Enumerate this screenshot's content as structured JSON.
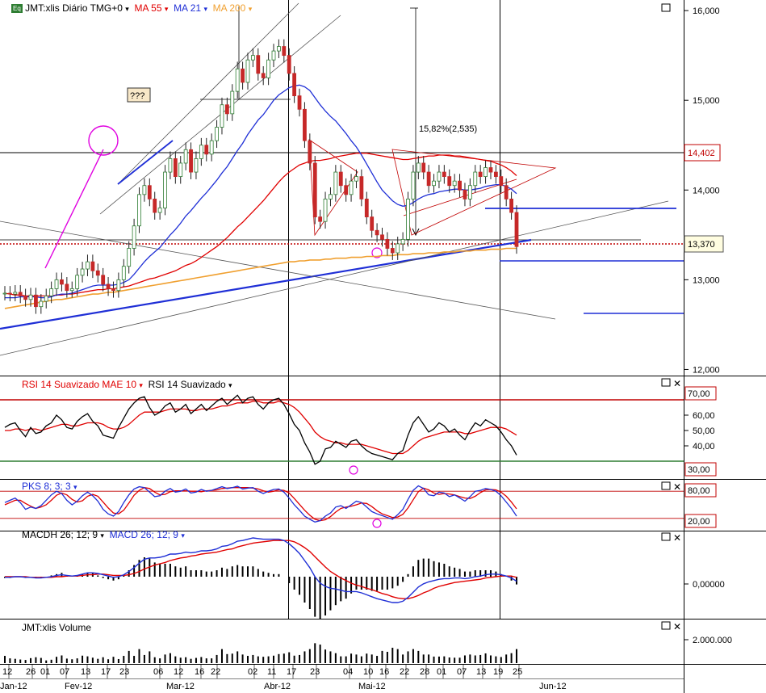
{
  "colors": {
    "up": "#2e7d32",
    "down": "#c62828",
    "ma55": "#e00000",
    "ma21": "#1f2fd6",
    "ma200": "#f0a030",
    "rsi": "#000000",
    "rsiMae": "#e00000",
    "pks_k": "#1f2fd6",
    "pks_d": "#e00000",
    "trend": "#1f2fd6",
    "level": "#c00000",
    "magenta": "#e000e0"
  },
  "header": {
    "eq_icon": "Eq",
    "symbol": "JMT:xlis Diário TMG+0",
    "ma55": "MA 55",
    "ma21": "MA 21",
    "ma200": "MA 200",
    "dropdown_glyph": "▾"
  },
  "annotations": {
    "question": "???",
    "pct_move": "15,82%(2,535)"
  },
  "panels": {
    "rsi": {
      "title_a": "RSI 14 Suavizado MAE 10",
      "title_b": "RSI 14 Suavizado",
      "levels": [
        "70,00",
        "30,00"
      ]
    },
    "pks": {
      "title": "PKS 8; 3; 3",
      "levels": [
        "80,00",
        "20,00"
      ]
    },
    "macd": {
      "title_a": "MACDH 26; 12; 9",
      "title_b": "MACD 26; 12; 9",
      "zero": "0,00000"
    },
    "volume": {
      "title": "JMT:xlis Volume",
      "tick": "2.000.000"
    }
  },
  "window_controls": {
    "maximize": "□",
    "close": "✕"
  },
  "chart_data": {
    "type": "candlestick",
    "price_axis": {
      "ticks": [
        "16,000",
        "15,000",
        "14,000",
        "13,000",
        "12,000"
      ],
      "ylim": [
        11.95,
        16.1
      ]
    },
    "price_tags": {
      "resistance": "14,402",
      "last": "13,370"
    },
    "x_day_labels": [
      "12",
      "26",
      "01",
      "07",
      "13",
      "17",
      "23",
      "06",
      "12",
      "16",
      "22",
      "02",
      "11",
      "17",
      "23",
      "04",
      "10",
      "16",
      "22",
      "28",
      "01",
      "07",
      "13",
      "19",
      "25"
    ],
    "x_month_labels": [
      "Jan-12",
      "Fev-12",
      "Mar-12",
      "Abr-12",
      "Mai-12",
      "Jun-12"
    ],
    "close": [
      12.85,
      12.84,
      12.86,
      12.82,
      12.78,
      12.83,
      12.7,
      12.76,
      12.82,
      12.9,
      13.0,
      12.95,
      12.88,
      12.9,
      13.05,
      13.12,
      13.2,
      13.1,
      13.05,
      12.95,
      12.9,
      12.88,
      13.0,
      13.15,
      13.35,
      13.6,
      13.95,
      14.05,
      13.9,
      13.75,
      13.8,
      14.2,
      14.35,
      14.15,
      14.3,
      14.45,
      14.2,
      14.35,
      14.5,
      14.4,
      14.55,
      14.7,
      14.95,
      14.85,
      15.1,
      15.35,
      15.2,
      15.45,
      15.5,
      15.3,
      15.25,
      15.45,
      15.55,
      15.6,
      15.5,
      15.3,
      15.05,
      14.9,
      14.55,
      14.3,
      13.7,
      13.65,
      13.9,
      13.95,
      14.2,
      14.05,
      13.95,
      14.1,
      14.15,
      13.9,
      13.7,
      13.55,
      13.5,
      13.45,
      13.35,
      13.3,
      13.4,
      13.45,
      13.9,
      14.2,
      14.3,
      14.2,
      14.05,
      14.1,
      14.2,
      14.15,
      14.05,
      14.1,
      14.0,
      13.9,
      14.05,
      14.2,
      14.15,
      14.25,
      14.2,
      14.15,
      14.05,
      13.9,
      13.75,
      13.37
    ],
    "ma21": [
      12.8,
      12.8,
      12.8,
      12.81,
      12.81,
      12.81,
      12.81,
      12.8,
      12.8,
      12.81,
      12.83,
      12.84,
      12.84,
      12.85,
      12.87,
      12.89,
      12.91,
      12.93,
      12.94,
      12.94,
      12.94,
      12.94,
      12.95,
      12.97,
      13.0,
      13.06,
      13.13,
      13.2,
      13.26,
      13.31,
      13.36,
      13.43,
      13.5,
      13.56,
      13.63,
      13.71,
      13.77,
      13.84,
      13.91,
      13.97,
      14.04,
      14.11,
      14.19,
      14.26,
      14.35,
      14.44,
      14.52,
      14.62,
      14.7,
      14.78,
      14.84,
      14.92,
      15.0,
      15.06,
      15.1,
      15.14,
      15.16,
      15.17,
      15.15,
      15.11,
      15.03,
      14.95,
      14.88,
      14.82,
      14.77,
      14.7,
      14.63,
      14.55,
      14.48,
      14.39,
      14.29,
      14.19,
      14.09,
      14.0,
      13.94,
      13.88,
      13.84,
      13.82,
      13.83,
      13.86,
      13.9,
      13.93,
      13.95,
      13.96,
      13.98,
      13.99,
      14.0,
      14.01,
      14.01,
      14.0,
      14.0,
      14.01,
      14.02,
      14.04,
      14.05,
      14.06,
      14.06,
      14.04,
      14.01,
      13.96
    ],
    "ma55": [
      12.85,
      12.84,
      12.83,
      12.83,
      12.82,
      12.82,
      12.82,
      12.82,
      12.82,
      12.82,
      12.83,
      12.83,
      12.84,
      12.84,
      12.85,
      12.86,
      12.87,
      12.88,
      12.89,
      12.89,
      12.9,
      12.9,
      12.91,
      12.92,
      12.93,
      12.95,
      12.97,
      12.99,
      13.01,
      13.02,
      13.04,
      13.06,
      13.08,
      13.1,
      13.13,
      13.16,
      13.18,
      13.21,
      13.25,
      13.29,
      13.33,
      13.37,
      13.42,
      13.47,
      13.53,
      13.59,
      13.64,
      13.7,
      13.76,
      13.82,
      13.88,
      13.95,
      14.02,
      14.09,
      14.15,
      14.2,
      14.24,
      14.28,
      14.3,
      14.32,
      14.33,
      14.33,
      14.34,
      14.35,
      14.37,
      14.38,
      14.39,
      14.4,
      14.41,
      14.41,
      14.41,
      14.4,
      14.39,
      14.38,
      14.37,
      14.36,
      14.35,
      14.34,
      14.34,
      14.35,
      14.36,
      14.37,
      14.38,
      14.38,
      14.39,
      14.39,
      14.39,
      14.38,
      14.38,
      14.37,
      14.36,
      14.35,
      14.34,
      14.33,
      14.32,
      14.3,
      14.28,
      14.25,
      14.21,
      14.16
    ],
    "ma200": [
      12.68,
      12.69,
      12.7,
      12.71,
      12.72,
      12.73,
      12.74,
      12.75,
      12.76,
      12.77,
      12.78,
      12.78,
      12.79,
      12.8,
      12.81,
      12.82,
      12.83,
      12.84,
      12.84,
      12.85,
      12.86,
      12.86,
      12.87,
      12.88,
      12.89,
      12.9,
      12.91,
      12.92,
      12.93,
      12.94,
      12.95,
      12.96,
      12.97,
      12.98,
      12.99,
      13.0,
      13.01,
      13.02,
      13.03,
      13.04,
      13.05,
      13.06,
      13.07,
      13.08,
      13.09,
      13.1,
      13.11,
      13.12,
      13.13,
      13.14,
      13.15,
      13.16,
      13.17,
      13.18,
      13.19,
      13.2,
      13.2,
      13.21,
      13.21,
      13.22,
      13.22,
      13.22,
      13.23,
      13.23,
      13.24,
      13.24,
      13.24,
      13.25,
      13.25,
      13.25,
      13.26,
      13.26,
      13.26,
      13.27,
      13.27,
      13.27,
      13.28,
      13.28,
      13.28,
      13.29,
      13.29,
      13.29,
      13.3,
      13.3,
      13.3,
      13.31,
      13.31,
      13.31,
      13.32,
      13.32,
      13.32,
      13.33,
      13.33,
      13.33,
      13.34,
      13.34,
      13.34,
      13.35,
      13.35,
      13.35
    ],
    "rsi": [
      52,
      54,
      55,
      50,
      46,
      52,
      48,
      49,
      53,
      55,
      60,
      57,
      52,
      51,
      56,
      59,
      61,
      56,
      53,
      47,
      46,
      45,
      52,
      58,
      64,
      68,
      71,
      72,
      65,
      60,
      62,
      66,
      68,
      62,
      64,
      67,
      61,
      64,
      67,
      63,
      66,
      69,
      71,
      67,
      70,
      73,
      68,
      71,
      72,
      67,
      64,
      68,
      70,
      71,
      67,
      61,
      54,
      50,
      42,
      36,
      28,
      30,
      38,
      39,
      43,
      41,
      39,
      43,
      44,
      40,
      37,
      35,
      34,
      33,
      32,
      31,
      35,
      37,
      47,
      55,
      59,
      54,
      49,
      51,
      55,
      53,
      49,
      51,
      47,
      44,
      50,
      55,
      53,
      57,
      55,
      53,
      49,
      44,
      40,
      34
    ],
    "rsiMae": [
      50,
      50,
      51,
      51,
      50,
      51,
      51,
      50,
      51,
      52,
      53,
      54,
      54,
      53,
      53,
      54,
      55,
      55,
      55,
      54,
      52,
      51,
      51,
      52,
      54,
      57,
      60,
      62,
      62,
      62,
      62,
      63,
      64,
      64,
      64,
      64,
      63,
      63,
      64,
      64,
      64,
      65,
      66,
      66,
      67,
      68,
      68,
      68,
      69,
      69,
      68,
      68,
      68,
      69,
      68,
      67,
      65,
      62,
      58,
      54,
      49,
      46,
      44,
      43,
      42,
      42,
      41,
      41,
      41,
      41,
      40,
      39,
      38,
      37,
      36,
      35,
      35,
      35,
      37,
      40,
      43,
      45,
      46,
      47,
      48,
      49,
      49,
      49,
      49,
      48,
      48,
      49,
      50,
      51,
      52,
      52,
      52,
      51,
      49,
      47
    ],
    "pks_k": [
      55,
      60,
      65,
      55,
      40,
      45,
      42,
      48,
      60,
      72,
      80,
      75,
      60,
      50,
      58,
      70,
      78,
      70,
      58,
      40,
      30,
      25,
      35,
      55,
      72,
      85,
      90,
      88,
      78,
      68,
      70,
      80,
      86,
      78,
      80,
      85,
      76,
      78,
      84,
      80,
      82,
      86,
      90,
      86,
      88,
      91,
      85,
      87,
      88,
      80,
      75,
      80,
      84,
      85,
      78,
      65,
      50,
      38,
      25,
      18,
      12,
      15,
      25,
      32,
      45,
      48,
      42,
      50,
      58,
      55,
      45,
      35,
      30,
      26,
      22,
      18,
      28,
      40,
      62,
      82,
      92,
      86,
      72,
      70,
      78,
      76,
      68,
      72,
      65,
      58,
      68,
      80,
      82,
      86,
      84,
      80,
      70,
      56,
      42,
      25
    ],
    "pks_d": [
      50,
      55,
      60,
      60,
      53,
      47,
      42,
      45,
      50,
      60,
      71,
      76,
      72,
      62,
      56,
      59,
      69,
      73,
      69,
      56,
      43,
      32,
      30,
      38,
      54,
      71,
      82,
      88,
      86,
      78,
      72,
      73,
      79,
      81,
      81,
      81,
      80,
      80,
      79,
      81,
      82,
      83,
      86,
      87,
      88,
      88,
      88,
      88,
      87,
      85,
      81,
      78,
      80,
      83,
      82,
      76,
      64,
      51,
      38,
      27,
      18,
      15,
      17,
      24,
      34,
      42,
      45,
      47,
      50,
      54,
      53,
      46,
      37,
      30,
      26,
      22,
      23,
      29,
      43,
      61,
      79,
      87,
      83,
      76,
      73,
      75,
      74,
      72,
      68,
      65,
      64,
      69,
      77,
      83,
      84,
      83,
      78,
      69,
      56,
      41
    ],
    "macd": [
      -0.01,
      -0.01,
      0.0,
      0.0,
      -0.01,
      -0.01,
      -0.02,
      -0.02,
      -0.01,
      0.0,
      0.02,
      0.03,
      0.02,
      0.01,
      0.02,
      0.04,
      0.06,
      0.06,
      0.05,
      0.03,
      0.01,
      -0.01,
      0.0,
      0.03,
      0.08,
      0.14,
      0.21,
      0.27,
      0.29,
      0.29,
      0.3,
      0.32,
      0.35,
      0.35,
      0.36,
      0.38,
      0.37,
      0.38,
      0.4,
      0.4,
      0.41,
      0.43,
      0.47,
      0.48,
      0.51,
      0.55,
      0.56,
      0.58,
      0.6,
      0.59,
      0.58,
      0.58,
      0.58,
      0.58,
      0.56,
      0.51,
      0.44,
      0.36,
      0.25,
      0.14,
      0.0,
      -0.1,
      -0.15,
      -0.18,
      -0.19,
      -0.21,
      -0.23,
      -0.23,
      -0.23,
      -0.25,
      -0.28,
      -0.31,
      -0.34,
      -0.36,
      -0.38,
      -0.4,
      -0.4,
      -0.38,
      -0.32,
      -0.24,
      -0.16,
      -0.11,
      -0.08,
      -0.06,
      -0.04,
      -0.03,
      -0.03,
      -0.02,
      -0.02,
      -0.03,
      -0.02,
      0.0,
      0.01,
      0.03,
      0.04,
      0.04,
      0.03,
      0.01,
      -0.02,
      -0.07
    ],
    "macd_signal": [
      0.0,
      0.0,
      0.0,
      0.0,
      0.0,
      -0.01,
      -0.01,
      -0.01,
      -0.01,
      -0.01,
      0.0,
      0.0,
      0.01,
      0.01,
      0.01,
      0.02,
      0.03,
      0.03,
      0.04,
      0.04,
      0.03,
      0.02,
      0.02,
      0.02,
      0.03,
      0.05,
      0.08,
      0.12,
      0.15,
      0.18,
      0.2,
      0.22,
      0.25,
      0.27,
      0.29,
      0.3,
      0.32,
      0.33,
      0.35,
      0.36,
      0.37,
      0.38,
      0.4,
      0.42,
      0.43,
      0.46,
      0.48,
      0.5,
      0.52,
      0.53,
      0.54,
      0.55,
      0.56,
      0.56,
      0.56,
      0.56,
      0.54,
      0.5,
      0.45,
      0.39,
      0.31,
      0.23,
      0.15,
      0.08,
      0.03,
      -0.02,
      -0.06,
      -0.1,
      -0.13,
      -0.15,
      -0.18,
      -0.2,
      -0.23,
      -0.26,
      -0.28,
      -0.31,
      -0.33,
      -0.34,
      -0.34,
      -0.32,
      -0.29,
      -0.25,
      -0.22,
      -0.18,
      -0.15,
      -0.13,
      -0.11,
      -0.09,
      -0.08,
      -0.07,
      -0.06,
      -0.05,
      -0.04,
      -0.02,
      -0.01,
      0.0,
      0.01,
      0.01,
      0.01,
      -0.01
    ],
    "volume": [
      320000,
      210000,
      190000,
      160000,
      140000,
      220000,
      260000,
      230000,
      120000,
      150000,
      280000,
      340000,
      200000,
      170000,
      210000,
      330000,
      300000,
      240000,
      190000,
      260000,
      170000,
      280000,
      180000,
      320000,
      540000,
      320000,
      620000,
      360000,
      520000,
      260000,
      210000,
      380000,
      440000,
      300000,
      240000,
      260000,
      190000,
      230000,
      270000,
      210000,
      210000,
      360000,
      620000,
      400000,
      420000,
      520000,
      380000,
      320000,
      360000,
      300000,
      280000,
      300000,
      330000,
      400000,
      420000,
      480000,
      330000,
      360000,
      520000,
      620000,
      880000,
      820000,
      600000,
      520000,
      440000,
      300000,
      300000,
      420000,
      380000,
      300000,
      420000,
      380000,
      320000,
      540000,
      500000,
      680000,
      620000,
      380000,
      520000,
      620000,
      540000,
      380000,
      380000,
      290000,
      290000,
      300000,
      250000,
      240000,
      240000,
      340000,
      380000,
      340000,
      360000,
      430000,
      340000,
      300000,
      270000,
      380000,
      440000,
      620000
    ]
  }
}
